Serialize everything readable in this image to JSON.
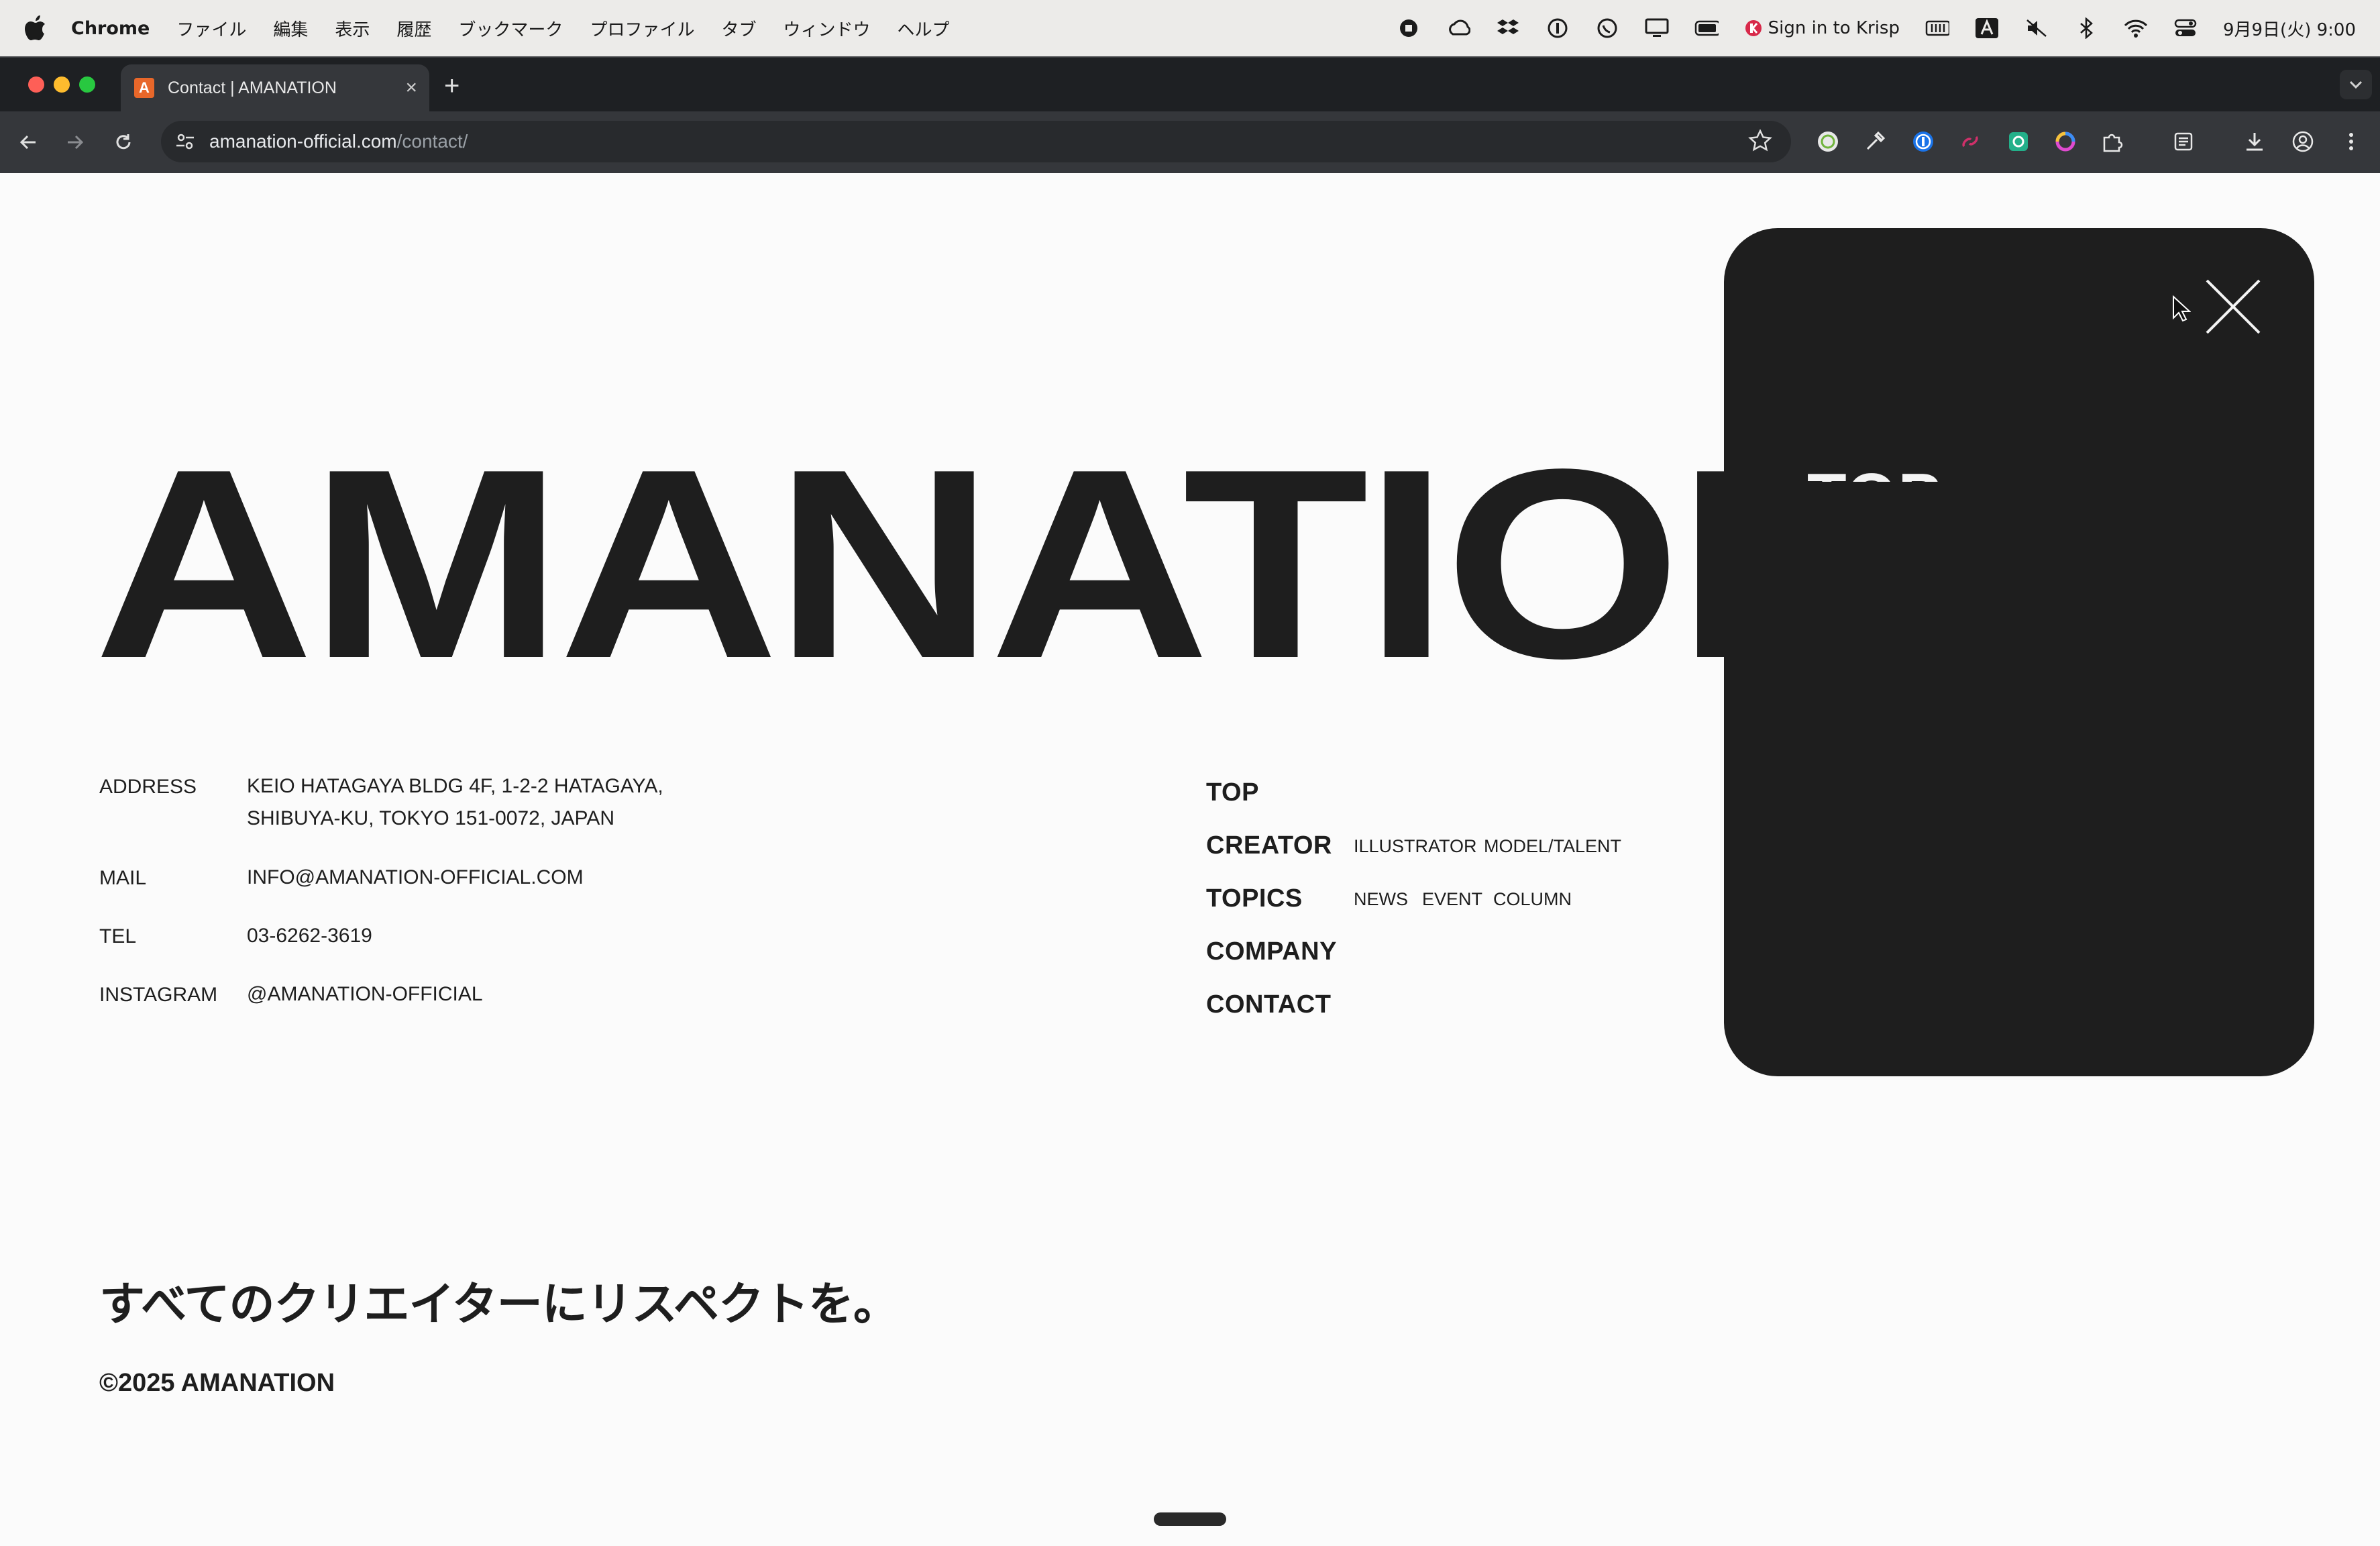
{
  "menubar": {
    "app_name": "Chrome",
    "menu_items": [
      "ファイル",
      "編集",
      "表示",
      "履歴",
      "ブックマーク",
      "プロファイル",
      "タブ",
      "ウィンドウ",
      "ヘルプ"
    ],
    "krisp_label": "Sign in to Krisp",
    "datetime": "9月9日(火) 9:00"
  },
  "browser": {
    "tab_title": "Contact | AMANATION",
    "tab_favicon_letter": "A",
    "url_host": "amanation-official.com",
    "url_path": "/contact/"
  },
  "page": {
    "hero_title": "AMANATION",
    "info": {
      "address_label": "ADDRESS",
      "address_line1": "KEIO HATAGAYA BLDG 4F, 1-2-2 HATAGAYA,",
      "address_line2": "SHIBUYA-KU, TOKYO 151-0072, JAPAN",
      "mail_label": "MAIL",
      "mail_value": "INFO@AMANATION-OFFICIAL.COM",
      "tel_label": "TEL",
      "tel_value": "03-6262-3619",
      "instagram_label": "INSTAGRAM",
      "instagram_value": "@AMANATION-OFFICIAL"
    },
    "nav": {
      "top": "TOP",
      "creator": "CREATOR",
      "creator_sub": [
        "ILLUSTRATOR",
        "MODEL/TALENT"
      ],
      "topics": "TOPICS",
      "topics_sub": [
        "NEWS",
        "EVENT",
        "COLUMN"
      ],
      "company": "COMPANY",
      "contact": "CONTACT"
    },
    "tagline": "すべてのクリエイターにリスペクトを。",
    "copyright": "©2025 AMANATION"
  },
  "overlay_menu": {
    "first_item_partial": "TOP"
  },
  "colors": {
    "page_bg": "#fbfbfb",
    "ink": "#1e1e1e",
    "panel_bg": "#1e1e1e",
    "favicon": "#e8672a"
  }
}
